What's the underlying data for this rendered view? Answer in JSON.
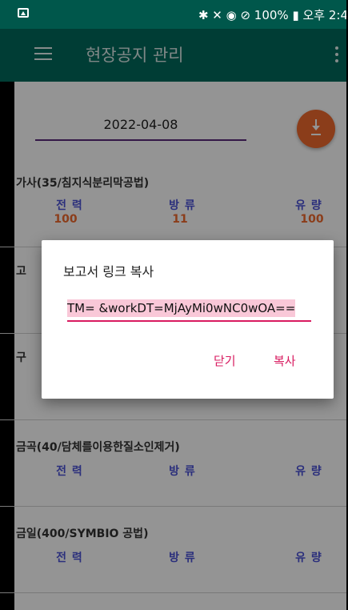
{
  "status_bar": {
    "right_text": "✱ ✕ ◉ ⊘ 100% ▮ 오후 2:4",
    "icons": [
      "gallery-icon",
      "bluetooth-icon",
      "mute-icon",
      "wifi-icon",
      "block-icon",
      "battery-icon"
    ]
  },
  "app_bar": {
    "title": "현장공지 관리",
    "icons": [
      "menu-icon",
      "more-vert-icon"
    ]
  },
  "date_field": {
    "value": "2022-04-08"
  },
  "fab": {
    "icon": "download-icon",
    "color": "#f0692d"
  },
  "sites": [
    {
      "name": "가사(35/침지식분리막공법)",
      "metrics": [
        "전 력",
        "방 류",
        "유 량"
      ],
      "values": [
        "100",
        "11",
        "100"
      ]
    },
    {
      "name": "고",
      "metrics": [],
      "values": []
    },
    {
      "name": "구",
      "metrics": [],
      "values": []
    },
    {
      "name": "금곡(40/담체를이용한질소인제거)",
      "metrics": [
        "전 력",
        "방 류",
        "유 량"
      ],
      "values": []
    },
    {
      "name": "금일(400/SYMBIO 공법)",
      "metrics": [
        "전 력",
        "방 류",
        "유 량"
      ],
      "values": []
    }
  ],
  "dialog": {
    "title": "보고서 링크 복사",
    "field_value": "TM= &workDT=MjAyMi0wNC0wOA==",
    "cancel_label": "닫기",
    "copy_label": "복사"
  },
  "colors": {
    "primary": "#00695c",
    "status": "#00574b",
    "accent": "#d81b60",
    "metric": "#4a52d6",
    "value": "#f0692d"
  }
}
